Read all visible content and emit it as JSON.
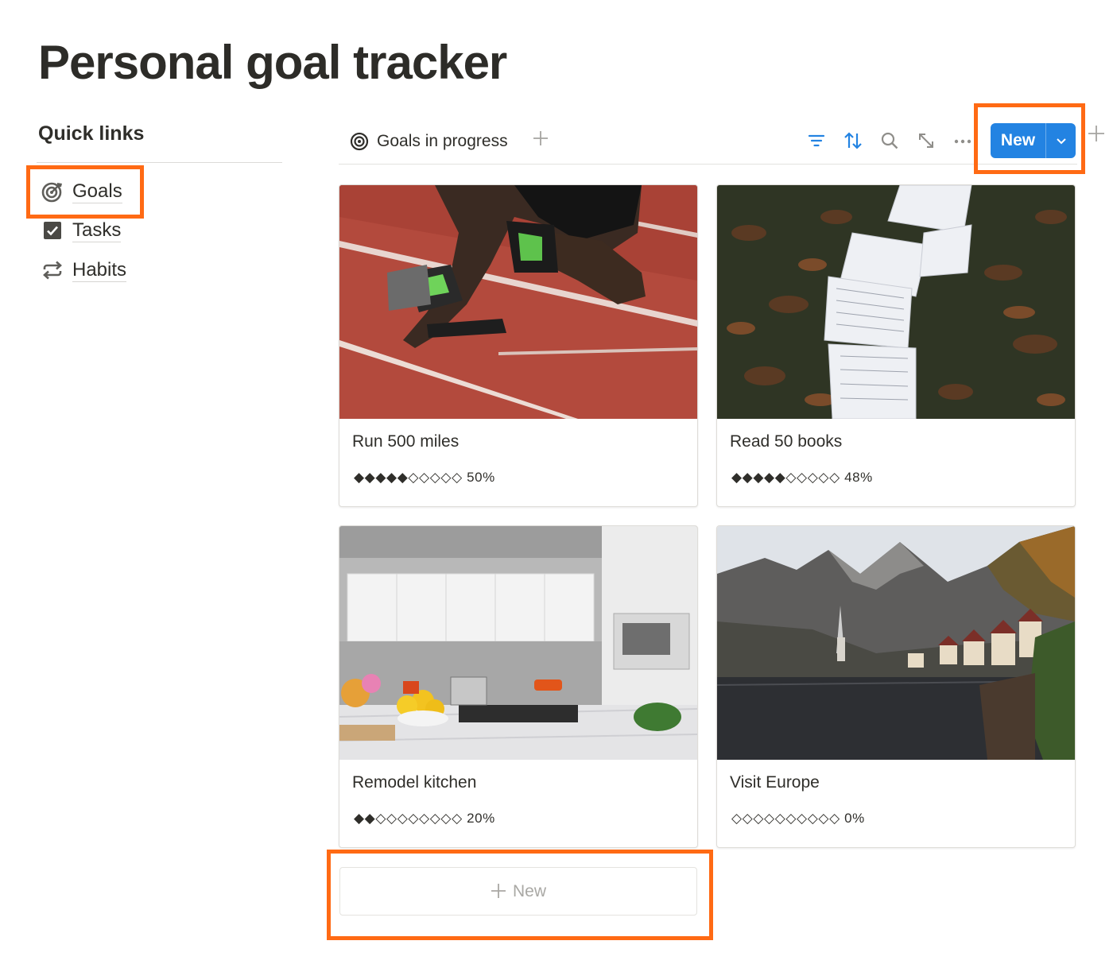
{
  "page": {
    "title": "Personal goal tracker"
  },
  "quick_links": {
    "heading": "Quick links",
    "items": [
      {
        "label": "Goals",
        "icon": "target-icon"
      },
      {
        "label": "Tasks",
        "icon": "checkbox-icon"
      },
      {
        "label": "Habits",
        "icon": "repeat-icon"
      }
    ]
  },
  "toolbar": {
    "view_label": "Goals in progress",
    "view_icon": "target-icon",
    "icons": [
      "filter-icon",
      "sort-icon",
      "search-icon",
      "expand-icon",
      "more-icon"
    ],
    "new_label": "New",
    "accent": "#2383e2"
  },
  "cards": [
    {
      "title": "Run 500 miles",
      "progress_bar": "◆◆◆◆◆◇◇◇◇◇",
      "progress_label": "50%",
      "progress": 0.5,
      "cover": "running-track"
    },
    {
      "title": "Read 50 books",
      "progress_bar": "◆◆◆◆◆◇◇◇◇◇",
      "progress_label": "48%",
      "progress": 0.48,
      "cover": "open-books-on-leaves"
    },
    {
      "title": "Remodel kitchen",
      "progress_bar": "◆◆◇◇◇◇◇◇◇◇",
      "progress_label": "20%",
      "progress": 0.2,
      "cover": "white-kitchen"
    },
    {
      "title": "Visit Europe",
      "progress_bar": "◇◇◇◇◇◇◇◇◇◇",
      "progress_label": "0%",
      "progress": 0,
      "cover": "alpine-lake-village"
    }
  ],
  "new_card": {
    "label": "New"
  },
  "highlight_color": "#ff6a14"
}
